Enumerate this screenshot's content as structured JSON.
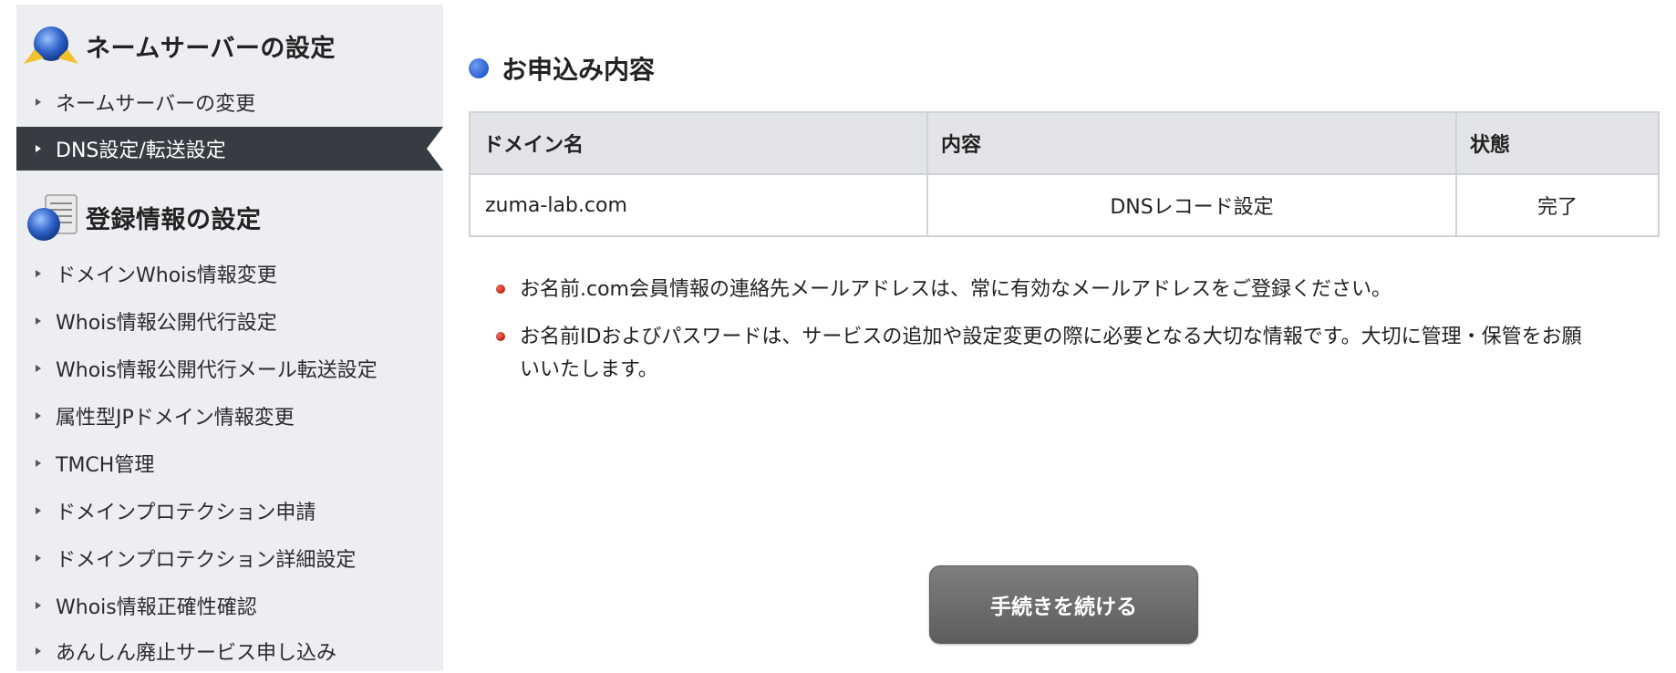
{
  "sidebar": {
    "nameserver_section": {
      "title": "ネームサーバーの設定",
      "items": [
        {
          "label": "ネームサーバーの変更",
          "active": false
        },
        {
          "label": "DNS設定/転送設定",
          "active": true
        }
      ]
    },
    "registration_section": {
      "title": "登録情報の設定",
      "items": [
        {
          "label": "ドメインWhois情報変更"
        },
        {
          "label": "Whois情報公開代行設定"
        },
        {
          "label": "Whois情報公開代行メール転送設定"
        },
        {
          "label": "属性型JPドメイン情報変更"
        },
        {
          "label": "TMCH管理"
        },
        {
          "label": "ドメインプロテクション申請"
        },
        {
          "label": "ドメインプロテクション詳細設定"
        },
        {
          "label": "Whois情報正確性確認"
        },
        {
          "label": "あんしん廃止サービス申し込み"
        }
      ]
    }
  },
  "main": {
    "title": "お申込み内容",
    "table": {
      "headers": [
        "ドメイン名",
        "内容",
        "状態"
      ],
      "rows": [
        [
          "zuma-lab.com",
          "DNSレコード設定",
          "完了"
        ]
      ]
    },
    "notes": [
      "お名前.com会員情報の連絡先メールアドレスは、常に有効なメールアドレスをご登録ください。",
      "お名前IDおよびパスワードは、サービスの追加や設定変更の際に必要となる大切な情報です。大切に管理・保管をお願いいたします。"
    ],
    "continue_button": "手続きを続ける"
  },
  "colors": {
    "sidebar_bg": "#eceef2",
    "active_item_bg": "#363c42",
    "table_header_bg": "#e2e4e8",
    "title_dot": "#2a5fcf",
    "note_bullet": "#c02010",
    "button_bg": "#6e6e6e"
  },
  "icons": {
    "nameserver": "globe-with-hands-icon",
    "registration": "globe-with-document-icon"
  }
}
